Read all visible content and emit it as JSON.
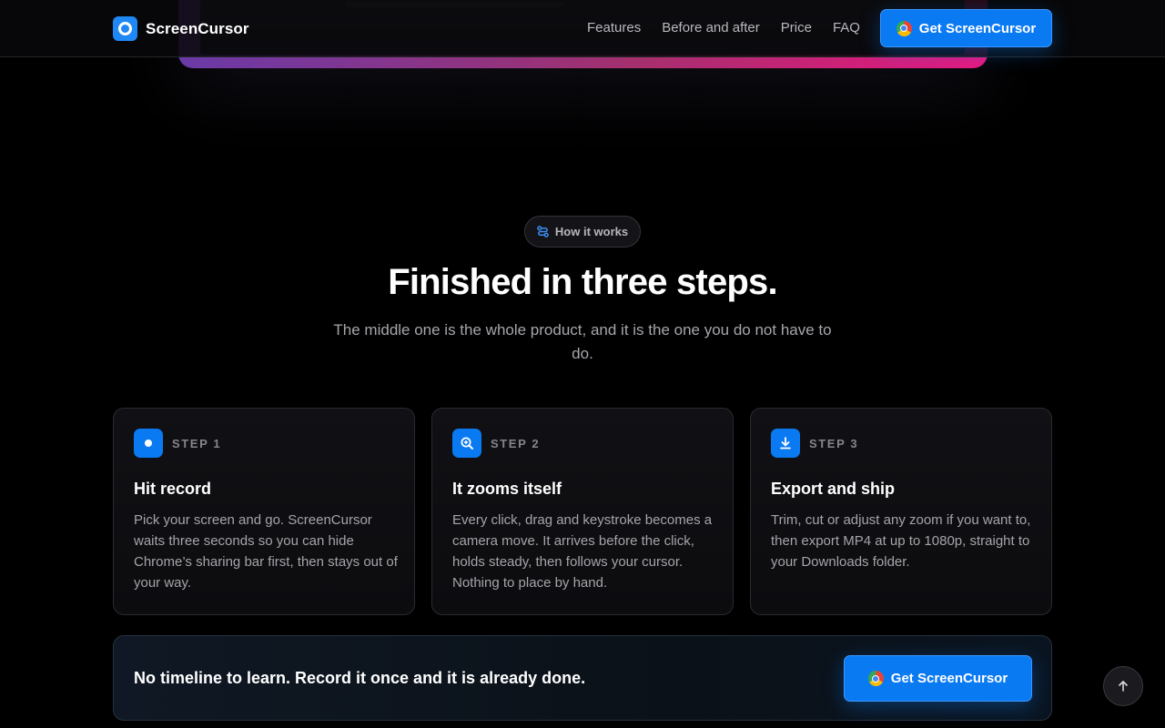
{
  "nav": {
    "brand": "ScreenCursor",
    "links": [
      "Features",
      "Before and after",
      "Price",
      "FAQ"
    ],
    "cta_label": "Get ScreenCursor"
  },
  "section": {
    "badge": "How it works",
    "title": "Finished in three steps.",
    "subtitle": "The middle one is the whole product, and it is the one you do not have to do."
  },
  "steps": [
    {
      "label": "STEP 1",
      "icon": "record-dot-icon",
      "title": "Hit record",
      "body": "Pick your screen and go. ScreenCursor waits three seconds so you can hide Chrome’s sharing bar first, then stays out of your way."
    },
    {
      "label": "STEP 2",
      "icon": "zoom-icon",
      "title": "It zooms itself",
      "body": "Every click, drag and keystroke becomes a camera move. It arrives before the click, holds steady, then follows your cursor. Nothing to place by hand."
    },
    {
      "label": "STEP 3",
      "icon": "download-icon",
      "title": "Export and ship",
      "body": "Trim, cut or adjust any zoom if you want to, then export MP4 at up to 1080p, straight to your Downloads folder."
    }
  ],
  "banner": {
    "text": "No timeline to learn. Record it once and it is already done.",
    "cta_label": "Get ScreenCursor"
  },
  "colors": {
    "accent": "#0a7af2",
    "background": "#000000",
    "hero_gradient_start": "#6a3aa8",
    "hero_gradient_end": "#e9177f"
  }
}
